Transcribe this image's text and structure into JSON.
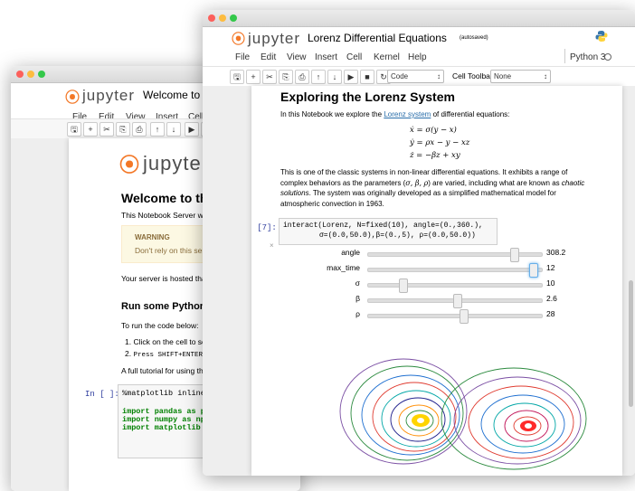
{
  "back_window": {
    "title": "Welcome to P",
    "menu": [
      "File",
      "Edit",
      "View",
      "Insert",
      "Cell"
    ],
    "toolbar_icons": [
      "save-icon",
      "plus-icon",
      "cut-icon",
      "copy-icon",
      "paste-icon",
      "up-arrow-icon",
      "down-arrow-icon",
      "play-icon",
      "stop-icon"
    ],
    "notebook_heading": "Welcome to the",
    "intro": "This Notebook Server was",
    "warning_title": "WARNING",
    "warning_text": "Don't rely on this serv",
    "hosted_text": "Your server is hosted thar",
    "section_heading": "Run some Python c",
    "run_intro": "To run the code below:",
    "steps": [
      "Click on the cell to se",
      "Press SHIFT+ENTER"
    ],
    "tutorial": "A full tutorial for using the",
    "code_prompt": "In [ ]:",
    "code_lines": [
      "%matplotlib inline",
      "import pandas as pd",
      "import numpy as np",
      "import matplotlib"
    ]
  },
  "front_window": {
    "title": "Lorenz Differential Equations",
    "autosave": "(autosaved)",
    "menu": [
      "File",
      "Edit",
      "View",
      "Insert",
      "Cell",
      "Kernel",
      "Help"
    ],
    "kernel": "Python 3",
    "toolbar_icons": [
      "save-icon",
      "plus-icon",
      "cut-icon",
      "copy-icon",
      "paste-icon",
      "up-arrow-icon",
      "down-arrow-icon",
      "play-icon",
      "stop-icon",
      "restart-icon"
    ],
    "cell_type": "Code",
    "cell_toolbar_label": "Cell Toolbar:",
    "cell_toolbar_value": "None",
    "heading": "Exploring the Lorenz System",
    "intro_pre": "In this Notebook we explore the",
    "intro_link": "Lorenz system",
    "intro_post": "of differential equations:",
    "equations": [
      "ẋ = σ(y − x)",
      "ẏ = ρx − y − xz",
      "ż = −βz + xy"
    ],
    "para": "This is one of the classic systems in non-linear differential equations. It exhibits a range of complex behaviors as the parameters (σ, β, ρ) are varied, including what are known as chaotic solutions. The system was originally developed as a simplified mathematical model for atmospheric convection in 1963.",
    "para_line1": "This is one of the classic systems in non-linear differential equations. It exhibits a range of",
    "para_line2_pre": "complex behaviors as the parameters (",
    "para_params": "σ, β, ρ",
    "para_line2_post": ") are varied, including what are known as",
    "para_em": "chaotic",
    "para_line3_em": "solutions",
    "para_line3_post": ". The system was originally developed as a simplified mathematical model for",
    "para_line4": "atmospheric convection in 1963.",
    "code_prompt": "In [7]:",
    "code_line1": "interact(Lorenz, N=fixed(10), angle=(0.,360.),",
    "code_line2": "σ=(0.0,50.0),β=(0.,5), ρ=(0.0,50.0))",
    "close_glyph": "×",
    "sliders": [
      {
        "label": "angle",
        "value": "308.2",
        "fraction": 0.856
      },
      {
        "label": "max_time",
        "value": "12",
        "fraction": 0.97
      },
      {
        "label": "σ",
        "value": "10",
        "fraction": 0.2
      },
      {
        "label": "β",
        "value": "2.6",
        "fraction": 0.52
      },
      {
        "label": "ρ",
        "value": "28",
        "fraction": 0.56
      }
    ],
    "colors": {
      "accent": "#f37726",
      "link": "#296eaa",
      "prompt": "#303f9f",
      "keyword": "#008000"
    }
  }
}
